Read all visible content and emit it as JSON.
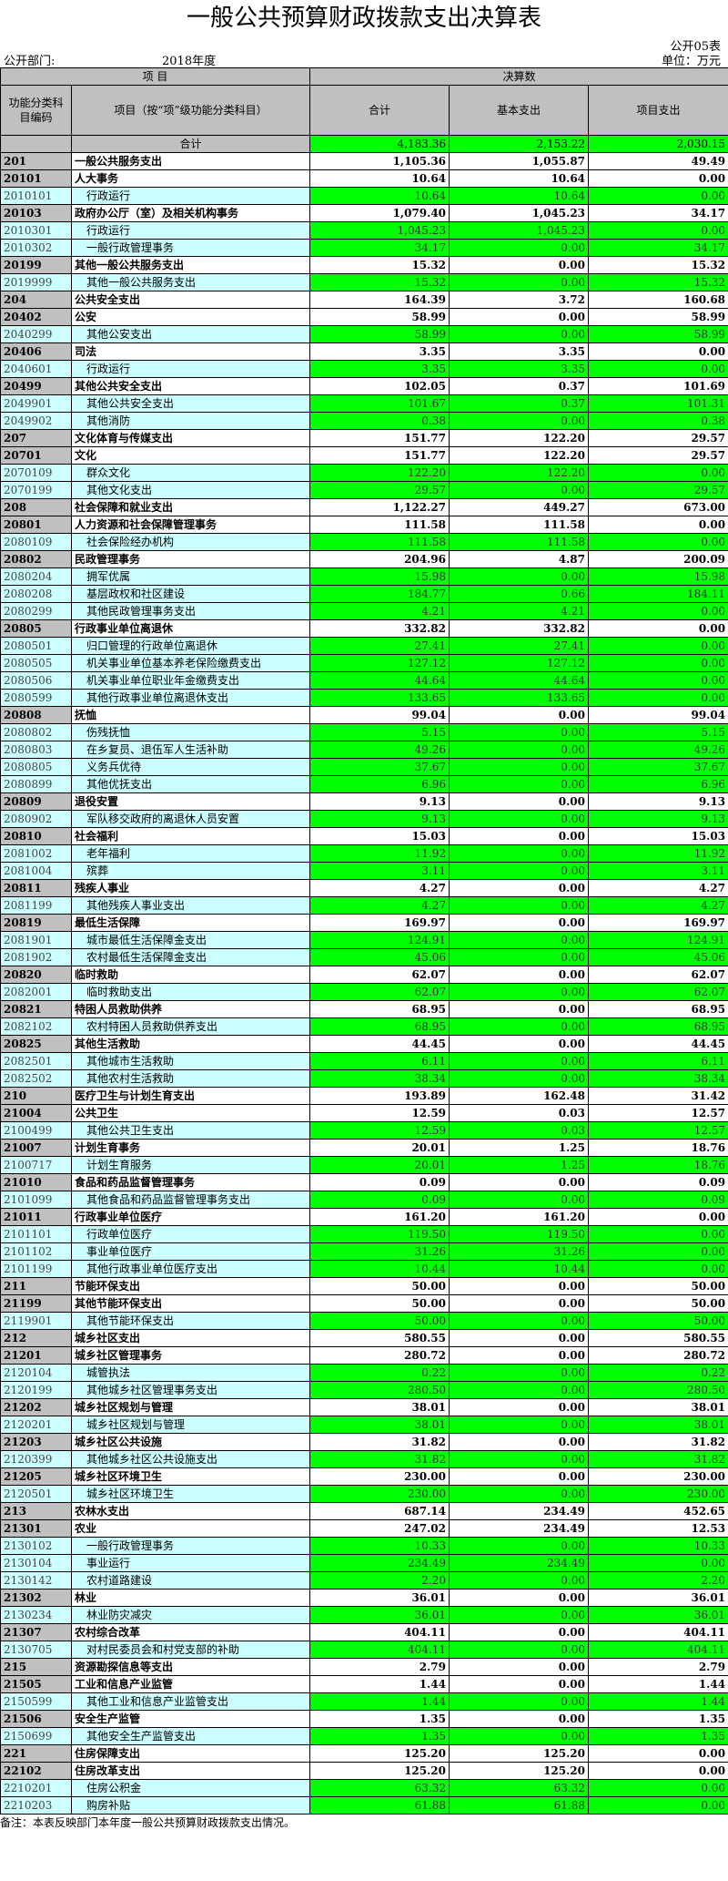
{
  "title": "一般公共预算财政拨款支出决算表",
  "form_no": "公开05表",
  "dept_label": "公开部门:",
  "year": "2018年度",
  "unit": "单位：万元",
  "headers": {
    "item": "项    目",
    "budget": "决算数",
    "code": "功能分类科目编码",
    "name": "项目（按“项”级功能分类科目）",
    "total": "合计",
    "basic": "基本支出",
    "project": "项目支出"
  },
  "note": "备注：本表反映部门本年度一般公共预算财政拨款支出情况。",
  "rows": [
    {
      "lvl": "tot",
      "code": "",
      "name": "合计",
      "total": "4,183.36",
      "basic": "2,153.22",
      "project": "2,030.15"
    },
    {
      "lvl": "l1",
      "code": "201",
      "name": "一般公共服务支出",
      "total": "1,105.36",
      "basic": "1,055.87",
      "project": "49.49"
    },
    {
      "lvl": "l2",
      "code": "20101",
      "name": "人大事务",
      "total": "10.64",
      "basic": "10.64",
      "project": "0.00"
    },
    {
      "lvl": "l3",
      "code": "2010101",
      "name": "行政运行",
      "total": "10.64",
      "basic": "10.64",
      "project": "0.00"
    },
    {
      "lvl": "l2",
      "code": "20103",
      "name": "政府办公厅（室）及相关机构事务",
      "total": "1,079.40",
      "basic": "1,045.23",
      "project": "34.17"
    },
    {
      "lvl": "l3",
      "code": "2010301",
      "name": "行政运行",
      "total": "1,045.23",
      "basic": "1,045.23",
      "project": "0.00"
    },
    {
      "lvl": "l3",
      "code": "2010302",
      "name": "一般行政管理事务",
      "total": "34.17",
      "basic": "0.00",
      "project": "34.17"
    },
    {
      "lvl": "l2",
      "code": "20199",
      "name": "其他一般公共服务支出",
      "total": "15.32",
      "basic": "0.00",
      "project": "15.32"
    },
    {
      "lvl": "l3",
      "code": "2019999",
      "name": "其他一般公共服务支出",
      "total": "15.32",
      "basic": "0.00",
      "project": "15.32"
    },
    {
      "lvl": "l1",
      "code": "204",
      "name": "公共安全支出",
      "total": "164.39",
      "basic": "3.72",
      "project": "160.68"
    },
    {
      "lvl": "l2",
      "code": "20402",
      "name": "公安",
      "total": "58.99",
      "basic": "0.00",
      "project": "58.99"
    },
    {
      "lvl": "l3",
      "code": "2040299",
      "name": "其他公安支出",
      "total": "58.99",
      "basic": "0.00",
      "project": "58.99"
    },
    {
      "lvl": "l2",
      "code": "20406",
      "name": "司法",
      "total": "3.35",
      "basic": "3.35",
      "project": "0.00"
    },
    {
      "lvl": "l3",
      "code": "2040601",
      "name": "行政运行",
      "total": "3.35",
      "basic": "3.35",
      "project": "0.00"
    },
    {
      "lvl": "l2",
      "code": "20499",
      "name": "其他公共安全支出",
      "total": "102.05",
      "basic": "0.37",
      "project": "101.69"
    },
    {
      "lvl": "l3",
      "code": "2049901",
      "name": "其他公共安全支出",
      "total": "101.67",
      "basic": "0.37",
      "project": "101.31"
    },
    {
      "lvl": "l3",
      "code": "2049902",
      "name": "其他消防",
      "total": "0.38",
      "basic": "0.00",
      "project": "0.38"
    },
    {
      "lvl": "l1",
      "code": "207",
      "name": "文化体育与传媒支出",
      "total": "151.77",
      "basic": "122.20",
      "project": "29.57"
    },
    {
      "lvl": "l2",
      "code": "20701",
      "name": "文化",
      "total": "151.77",
      "basic": "122.20",
      "project": "29.57"
    },
    {
      "lvl": "l3",
      "code": "2070109",
      "name": "群众文化",
      "total": "122.20",
      "basic": "122.20",
      "project": "0.00"
    },
    {
      "lvl": "l3",
      "code": "2070199",
      "name": "其他文化支出",
      "total": "29.57",
      "basic": "0.00",
      "project": "29.57"
    },
    {
      "lvl": "l1",
      "code": "208",
      "name": "社会保障和就业支出",
      "total": "1,122.27",
      "basic": "449.27",
      "project": "673.00"
    },
    {
      "lvl": "l2",
      "code": "20801",
      "name": "人力资源和社会保障管理事务",
      "total": "111.58",
      "basic": "111.58",
      "project": "0.00"
    },
    {
      "lvl": "l3",
      "code": "2080109",
      "name": "社会保险经办机构",
      "total": "111.58",
      "basic": "111.58",
      "project": "0.00"
    },
    {
      "lvl": "l2",
      "code": "20802",
      "name": "民政管理事务",
      "total": "204.96",
      "basic": "4.87",
      "project": "200.09"
    },
    {
      "lvl": "l3",
      "code": "2080204",
      "name": "拥军优属",
      "total": "15.98",
      "basic": "0.00",
      "project": "15.98"
    },
    {
      "lvl": "l3",
      "code": "2080208",
      "name": "基层政权和社区建设",
      "total": "184.77",
      "basic": "0.66",
      "project": "184.11"
    },
    {
      "lvl": "l3",
      "code": "2080299",
      "name": "其他民政管理事务支出",
      "total": "4.21",
      "basic": "4.21",
      "project": "0.00"
    },
    {
      "lvl": "l2",
      "code": "20805",
      "name": "行政事业单位离退休",
      "total": "332.82",
      "basic": "332.82",
      "project": "0.00"
    },
    {
      "lvl": "l3",
      "code": "2080501",
      "name": "归口管理的行政单位离退休",
      "total": "27.41",
      "basic": "27.41",
      "project": "0.00"
    },
    {
      "lvl": "l3",
      "code": "2080505",
      "name": "机关事业单位基本养老保险缴费支出",
      "total": "127.12",
      "basic": "127.12",
      "project": "0.00"
    },
    {
      "lvl": "l3",
      "code": "2080506",
      "name": "机关事业单位职业年金缴费支出",
      "total": "44.64",
      "basic": "44.64",
      "project": "0.00"
    },
    {
      "lvl": "l3",
      "code": "2080599",
      "name": "其他行政事业单位离退休支出",
      "total": "133.65",
      "basic": "133.65",
      "project": "0.00"
    },
    {
      "lvl": "l2",
      "code": "20808",
      "name": "抚恤",
      "total": "99.04",
      "basic": "0.00",
      "project": "99.04"
    },
    {
      "lvl": "l3",
      "code": "2080802",
      "name": "伤残抚恤",
      "total": "5.15",
      "basic": "0.00",
      "project": "5.15"
    },
    {
      "lvl": "l3",
      "code": "2080803",
      "name": "在乡复员、退伍军人生活补助",
      "total": "49.26",
      "basic": "0.00",
      "project": "49.26"
    },
    {
      "lvl": "l3",
      "code": "2080805",
      "name": "义务兵优待",
      "total": "37.67",
      "basic": "0.00",
      "project": "37.67"
    },
    {
      "lvl": "l3",
      "code": "2080899",
      "name": "其他优抚支出",
      "total": "6.96",
      "basic": "0.00",
      "project": "6.96"
    },
    {
      "lvl": "l2",
      "code": "20809",
      "name": "退役安置",
      "total": "9.13",
      "basic": "0.00",
      "project": "9.13"
    },
    {
      "lvl": "l3",
      "code": "2080902",
      "name": "军队移交政府的离退休人员安置",
      "total": "9.13",
      "basic": "0.00",
      "project": "9.13"
    },
    {
      "lvl": "l2",
      "code": "20810",
      "name": "社会福利",
      "total": "15.03",
      "basic": "0.00",
      "project": "15.03"
    },
    {
      "lvl": "l3",
      "code": "2081002",
      "name": "老年福利",
      "total": "11.92",
      "basic": "0.00",
      "project": "11.92"
    },
    {
      "lvl": "l3",
      "code": "2081004",
      "name": "殡葬",
      "total": "3.11",
      "basic": "0.00",
      "project": "3.11"
    },
    {
      "lvl": "l2",
      "code": "20811",
      "name": "残疾人事业",
      "total": "4.27",
      "basic": "0.00",
      "project": "4.27"
    },
    {
      "lvl": "l3",
      "code": "2081199",
      "name": "其他残疾人事业支出",
      "total": "4.27",
      "basic": "0.00",
      "project": "4.27"
    },
    {
      "lvl": "l2",
      "code": "20819",
      "name": "最低生活保障",
      "total": "169.97",
      "basic": "0.00",
      "project": "169.97"
    },
    {
      "lvl": "l3",
      "code": "2081901",
      "name": "城市最低生活保障金支出",
      "total": "124.91",
      "basic": "0.00",
      "project": "124.91"
    },
    {
      "lvl": "l3",
      "code": "2081902",
      "name": "农村最低生活保障金支出",
      "total": "45.06",
      "basic": "0.00",
      "project": "45.06"
    },
    {
      "lvl": "l2",
      "code": "20820",
      "name": "临时救助",
      "total": "62.07",
      "basic": "0.00",
      "project": "62.07"
    },
    {
      "lvl": "l3",
      "code": "2082001",
      "name": "临时救助支出",
      "total": "62.07",
      "basic": "0.00",
      "project": "62.07"
    },
    {
      "lvl": "l2",
      "code": "20821",
      "name": "特困人员救助供养",
      "total": "68.95",
      "basic": "0.00",
      "project": "68.95"
    },
    {
      "lvl": "l3",
      "code": "2082102",
      "name": "农村特困人员救助供养支出",
      "total": "68.95",
      "basic": "0.00",
      "project": "68.95"
    },
    {
      "lvl": "l2",
      "code": "20825",
      "name": "其他生活救助",
      "total": "44.45",
      "basic": "0.00",
      "project": "44.45"
    },
    {
      "lvl": "l3",
      "code": "2082501",
      "name": "其他城市生活救助",
      "total": "6.11",
      "basic": "0.00",
      "project": "6.11"
    },
    {
      "lvl": "l3",
      "code": "2082502",
      "name": "其他农村生活救助",
      "total": "38.34",
      "basic": "0.00",
      "project": "38.34"
    },
    {
      "lvl": "l1",
      "code": "210",
      "name": "医疗卫生与计划生育支出",
      "total": "193.89",
      "basic": "162.48",
      "project": "31.42"
    },
    {
      "lvl": "l2",
      "code": "21004",
      "name": "公共卫生",
      "total": "12.59",
      "basic": "0.03",
      "project": "12.57"
    },
    {
      "lvl": "l3",
      "code": "2100499",
      "name": "其他公共卫生支出",
      "total": "12.59",
      "basic": "0.03",
      "project": "12.57"
    },
    {
      "lvl": "l2",
      "code": "21007",
      "name": "计划生育事务",
      "total": "20.01",
      "basic": "1.25",
      "project": "18.76"
    },
    {
      "lvl": "l3",
      "code": "2100717",
      "name": "计划生育服务",
      "total": "20.01",
      "basic": "1.25",
      "project": "18.76"
    },
    {
      "lvl": "l2",
      "code": "21010",
      "name": "食品和药品监督管理事务",
      "total": "0.09",
      "basic": "0.00",
      "project": "0.09"
    },
    {
      "lvl": "l3",
      "code": "2101099",
      "name": "其他食品和药品监督管理事务支出",
      "total": "0.09",
      "basic": "0.00",
      "project": "0.09"
    },
    {
      "lvl": "l2",
      "code": "21011",
      "name": "行政事业单位医疗",
      "total": "161.20",
      "basic": "161.20",
      "project": "0.00"
    },
    {
      "lvl": "l3",
      "code": "2101101",
      "name": "行政单位医疗",
      "total": "119.50",
      "basic": "119.50",
      "project": "0.00"
    },
    {
      "lvl": "l3",
      "code": "2101102",
      "name": "事业单位医疗",
      "total": "31.26",
      "basic": "31.26",
      "project": "0.00"
    },
    {
      "lvl": "l3",
      "code": "2101199",
      "name": "其他行政事业单位医疗支出",
      "total": "10.44",
      "basic": "10.44",
      "project": "0.00"
    },
    {
      "lvl": "l1",
      "code": "211",
      "name": "节能环保支出",
      "total": "50.00",
      "basic": "0.00",
      "project": "50.00"
    },
    {
      "lvl": "l2",
      "code": "21199",
      "name": "其他节能环保支出",
      "total": "50.00",
      "basic": "0.00",
      "project": "50.00"
    },
    {
      "lvl": "l3",
      "code": "2119901",
      "name": "其他节能环保支出",
      "total": "50.00",
      "basic": "0.00",
      "project": "50.00"
    },
    {
      "lvl": "l1",
      "code": "212",
      "name": "城乡社区支出",
      "total": "580.55",
      "basic": "0.00",
      "project": "580.55"
    },
    {
      "lvl": "l2",
      "code": "21201",
      "name": "城乡社区管理事务",
      "total": "280.72",
      "basic": "0.00",
      "project": "280.72"
    },
    {
      "lvl": "l3",
      "code": "2120104",
      "name": "城管执法",
      "total": "0.22",
      "basic": "0.00",
      "project": "0.22"
    },
    {
      "lvl": "l3",
      "code": "2120199",
      "name": "其他城乡社区管理事务支出",
      "total": "280.50",
      "basic": "0.00",
      "project": "280.50"
    },
    {
      "lvl": "l2",
      "code": "21202",
      "name": "城乡社区规划与管理",
      "total": "38.01",
      "basic": "0.00",
      "project": "38.01"
    },
    {
      "lvl": "l3",
      "code": "2120201",
      "name": "城乡社区规划与管理",
      "total": "38.01",
      "basic": "0.00",
      "project": "38.01"
    },
    {
      "lvl": "l2",
      "code": "21203",
      "name": "城乡社区公共设施",
      "total": "31.82",
      "basic": "0.00",
      "project": "31.82"
    },
    {
      "lvl": "l3",
      "code": "2120399",
      "name": "其他城乡社区公共设施支出",
      "total": "31.82",
      "basic": "0.00",
      "project": "31.82"
    },
    {
      "lvl": "l2",
      "code": "21205",
      "name": "城乡社区环境卫生",
      "total": "230.00",
      "basic": "0.00",
      "project": "230.00"
    },
    {
      "lvl": "l3",
      "code": "2120501",
      "name": "城乡社区环境卫生",
      "total": "230.00",
      "basic": "0.00",
      "project": "230.00"
    },
    {
      "lvl": "l1",
      "code": "213",
      "name": "农林水支出",
      "total": "687.14",
      "basic": "234.49",
      "project": "452.65"
    },
    {
      "lvl": "l2",
      "code": "21301",
      "name": "农业",
      "total": "247.02",
      "basic": "234.49",
      "project": "12.53"
    },
    {
      "lvl": "l3",
      "code": "2130102",
      "name": "一般行政管理事务",
      "total": "10.33",
      "basic": "0.00",
      "project": "10.33"
    },
    {
      "lvl": "l3",
      "code": "2130104",
      "name": "事业运行",
      "total": "234.49",
      "basic": "234.49",
      "project": "0.00"
    },
    {
      "lvl": "l3",
      "code": "2130142",
      "name": "农村道路建设",
      "total": "2.20",
      "basic": "0.00",
      "project": "2.20"
    },
    {
      "lvl": "l2",
      "code": "21302",
      "name": "林业",
      "total": "36.01",
      "basic": "0.00",
      "project": "36.01"
    },
    {
      "lvl": "l3",
      "code": "2130234",
      "name": "林业防灾减灾",
      "total": "36.01",
      "basic": "0.00",
      "project": "36.01"
    },
    {
      "lvl": "l2",
      "code": "21307",
      "name": "农村综合改革",
      "total": "404.11",
      "basic": "0.00",
      "project": "404.11"
    },
    {
      "lvl": "l3",
      "code": "2130705",
      "name": "对村民委员会和村党支部的补助",
      "total": "404.11",
      "basic": "0.00",
      "project": "404.11"
    },
    {
      "lvl": "l1",
      "code": "215",
      "name": "资源勘探信息等支出",
      "total": "2.79",
      "basic": "0.00",
      "project": "2.79"
    },
    {
      "lvl": "l2",
      "code": "21505",
      "name": "工业和信息产业监管",
      "total": "1.44",
      "basic": "0.00",
      "project": "1.44"
    },
    {
      "lvl": "l3",
      "code": "2150599",
      "name": "其他工业和信息产业监管支出",
      "total": "1.44",
      "basic": "0.00",
      "project": "1.44"
    },
    {
      "lvl": "l2",
      "code": "21506",
      "name": "安全生产监管",
      "total": "1.35",
      "basic": "0.00",
      "project": "1.35"
    },
    {
      "lvl": "l3",
      "code": "2150699",
      "name": "其他安全生产监管支出",
      "total": "1.35",
      "basic": "0.00",
      "project": "1.35"
    },
    {
      "lvl": "l1",
      "code": "221",
      "name": "住房保障支出",
      "total": "125.20",
      "basic": "125.20",
      "project": "0.00"
    },
    {
      "lvl": "l2",
      "code": "22102",
      "name": "住房改革支出",
      "total": "125.20",
      "basic": "125.20",
      "project": "0.00"
    },
    {
      "lvl": "l3",
      "code": "2210201",
      "name": "住房公积金",
      "total": "63.32",
      "basic": "63.32",
      "project": "0.00"
    },
    {
      "lvl": "l3",
      "code": "2210203",
      "name": "购房补贴",
      "total": "61.88",
      "basic": "61.88",
      "project": "0.00"
    }
  ]
}
